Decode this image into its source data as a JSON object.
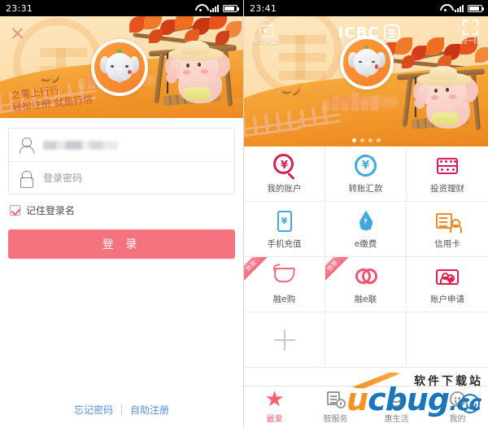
{
  "left_phone": {
    "statusbar": {
      "time": "23:31",
      "wifi_icon": "wifi-icon",
      "signal_icon": "signal-icon",
      "battery_icon": "battery-icon"
    },
    "banner": {
      "close_icon": "close-icon",
      "script_text": "之需上行行\n轻松注册 就是行信",
      "avatar_icon": "elephant-avatar-icon",
      "logo_watermark": "icbc-logo-watermark"
    },
    "form": {
      "username": {
        "icon": "user-icon",
        "value": "",
        "placeholder": ""
      },
      "password": {
        "icon": "lock-icon",
        "value": "",
        "placeholder": "登录密码"
      },
      "remember_label": "记住登录名",
      "remember_checked": true,
      "login_button": "登 录"
    },
    "links": {
      "forgot": "忘记密码",
      "register": "自助注册"
    }
  },
  "right_phone": {
    "statusbar": {
      "time": "23:41",
      "wifi_icon": "wifi-icon",
      "signal_icon": "signal-icon",
      "battery_icon": "battery-icon"
    },
    "header": {
      "logout_label": "安全退出",
      "logout_icon": "lock-plus-icon",
      "brand": "ICBC",
      "brand_mark": "icbc-emblem-icon",
      "scan_label": "扫一扫",
      "scan_icon": "scan-icon"
    },
    "banner": {
      "avatar_icon": "elephant-avatar-icon",
      "carousel_dots": 4,
      "carousel_active": 0
    },
    "grid": [
      {
        "label": "我的账户",
        "icon": "account-search-icon",
        "color": "#d81e5b",
        "ribbon": ""
      },
      {
        "label": "转账汇款",
        "icon": "transfer-icon",
        "color": "#3fa9e0",
        "ribbon": ""
      },
      {
        "label": "投资理财",
        "icon": "abacus-icon",
        "color": "#d81e5b",
        "ribbon": ""
      },
      {
        "label": "手机充值",
        "icon": "phone-recharge-icon",
        "color": "#3fa9e0",
        "ribbon": ""
      },
      {
        "label": "e缴费",
        "icon": "water-drop-icon",
        "color": "#3fa9e0",
        "ribbon": ""
      },
      {
        "label": "信用卡",
        "icon": "credit-card-icon",
        "color": "#f08b2b",
        "ribbon": ""
      },
      {
        "label": "融e购",
        "icon": "shopping-cart-icon",
        "color": "#f46a7e",
        "ribbon": "热卖"
      },
      {
        "label": "融e联",
        "icon": "link-rings-icon",
        "color": "#f0566f",
        "ribbon": "热荐"
      },
      {
        "label": "账户申请",
        "icon": "account-apply-icon",
        "color": "#e11f4c",
        "ribbon": ""
      },
      {
        "label": "",
        "icon": "add-plus-icon",
        "color": "#c9c9c9",
        "ribbon": ""
      },
      {
        "label": "",
        "icon": "",
        "color": "",
        "ribbon": ""
      },
      {
        "label": "",
        "icon": "",
        "color": "",
        "ribbon": ""
      }
    ],
    "tabbar": [
      {
        "label": "最爱",
        "icon": "star-icon",
        "active": true
      },
      {
        "label": "智服务",
        "icon": "service-clock-icon",
        "active": false
      },
      {
        "label": "惠生活",
        "icon": "cup-icon",
        "active": false
      },
      {
        "label": "我的",
        "icon": "smiley-icon",
        "active": false
      }
    ]
  },
  "watermark": {
    "chinese": "软件下载站",
    "u": "u",
    "c": "c",
    "b": "b",
    "u2": "u",
    "g": "g",
    "cc": ".cc"
  }
}
